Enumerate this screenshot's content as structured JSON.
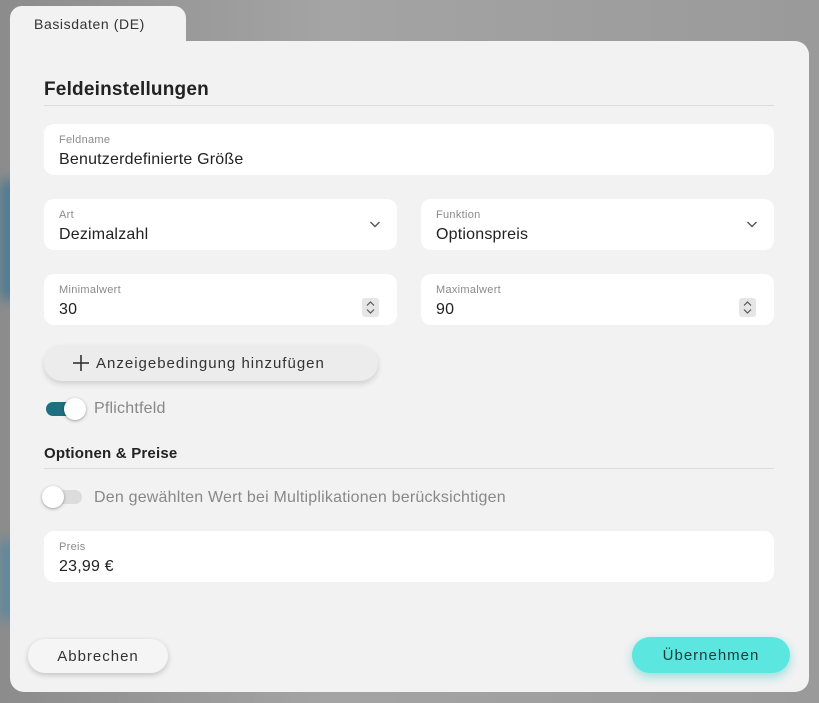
{
  "tab": {
    "label": "Basisdaten (DE)"
  },
  "section_field_settings": {
    "title": "Feldeinstellungen"
  },
  "field_name": {
    "label": "Feldname",
    "value": "Benutzerdefinierte Größe"
  },
  "art": {
    "label": "Art",
    "value": "Dezimalzahl"
  },
  "funktion": {
    "label": "Funktion",
    "value": "Optionspreis"
  },
  "min": {
    "label": "Minimalwert",
    "value": "30"
  },
  "max": {
    "label": "Maximalwert",
    "value": "90"
  },
  "add_condition": {
    "label": "Anzeigebedingung hinzufügen"
  },
  "required_toggle": {
    "label": "Pflichtfeld",
    "on": true
  },
  "section_options": {
    "title": "Optionen & Preise"
  },
  "multiply_toggle": {
    "label": "Den gewählten Wert bei Multiplikationen berücksichtigen",
    "on": false
  },
  "price": {
    "label": "Preis",
    "value": "23,99 €"
  },
  "footer": {
    "cancel_label": "Abbrechen",
    "apply_label": "Übernehmen"
  },
  "colors": {
    "toggle_on": "#1f6f80",
    "toggle_off": "#dcdcdc",
    "accent_button": "#5ce6e0"
  }
}
